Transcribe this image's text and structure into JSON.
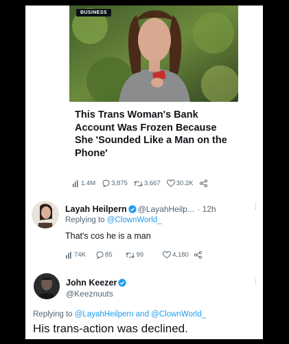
{
  "article": {
    "badge": "BUSINESS",
    "headline": "This Trans Woman's Bank Account Was Frozen Because She 'Sounded Like a Man on the Phone'"
  },
  "main_tweet_stats": {
    "views": "1.4M",
    "replies": "3,875",
    "retweets": "3,667",
    "likes": "30.2K"
  },
  "reply1": {
    "name": "Layah Heilpern",
    "handle": "@LayahHeilp...",
    "time": "· 12h",
    "replying_prefix": "Replying to",
    "replying_to": "@ClownWorld_",
    "text": "That's cos he is a man",
    "stats": {
      "views": "74K",
      "replies": "85",
      "retweets": "99",
      "likes": "4,180"
    }
  },
  "reply2": {
    "name": "John Keezer",
    "handle": "@Keeznuuts",
    "replying_prefix": "Replying to",
    "replying_to": "@LayahHeilpern and @ClownWorld_",
    "text": "His trans-action was declined."
  },
  "colors": {
    "link": "#1d9bf0",
    "verified": "#1d9bf0",
    "muted": "#536471",
    "frame": "#000000"
  },
  "icons": [
    "views-icon",
    "reply-icon",
    "retweet-icon",
    "like-icon",
    "share-icon",
    "verified-badge-icon",
    "more-icon"
  ]
}
